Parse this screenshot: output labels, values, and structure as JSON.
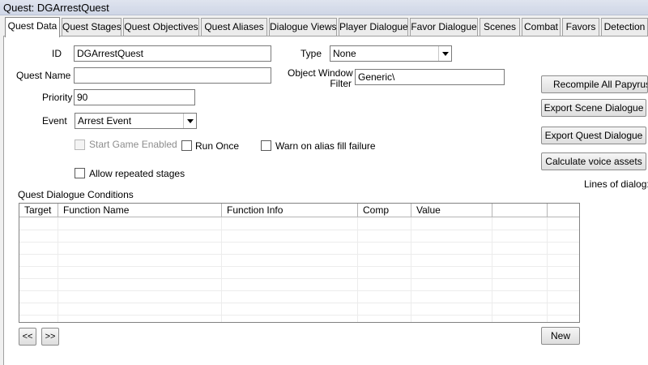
{
  "window": {
    "title": "Quest: DGArrestQuest"
  },
  "tabs": [
    {
      "label": "Quest Data",
      "active": true
    },
    {
      "label": "Quest Stages"
    },
    {
      "label": "Quest Objectives"
    },
    {
      "label": "Quest Aliases"
    },
    {
      "label": "Dialogue Views"
    },
    {
      "label": "Player Dialogue"
    },
    {
      "label": "Favor Dialogue"
    },
    {
      "label": "Scenes"
    },
    {
      "label": "Combat"
    },
    {
      "label": "Favors"
    },
    {
      "label": "Detection"
    }
  ],
  "form": {
    "id_label": "ID",
    "id_value": "DGArrestQuest",
    "quest_name_label": "Quest Name",
    "quest_name_value": "",
    "priority_label": "Priority",
    "priority_value": "90",
    "event_label": "Event",
    "event_value": "Arrest Event",
    "type_label": "Type",
    "type_value": "None",
    "owf_label_line1": "Object Window",
    "owf_label_line2": "Filter",
    "owf_value": "Generic\\",
    "start_game_enabled_label": "Start Game Enabled",
    "run_once_label": "Run Once",
    "warn_alias_label": "Warn on alias fill failure",
    "allow_repeated_label": "Allow repeated stages"
  },
  "actions": {
    "recompile": "Recompile All Papyrus Scripts",
    "export_scene": "Export Scene Dialogue",
    "export_quest": "Export Quest Dialogue",
    "calc_voice": "Calculate voice assets",
    "lines_of_dialog": "Lines of dialog:"
  },
  "conditions": {
    "title": "Quest Dialogue Conditions",
    "columns": [
      "Target",
      "Function Name",
      "Function Info",
      "Comp",
      "Value",
      "",
      ""
    ],
    "rows": []
  },
  "nav": {
    "prev": "<<",
    "next": ">>",
    "new": "New"
  }
}
